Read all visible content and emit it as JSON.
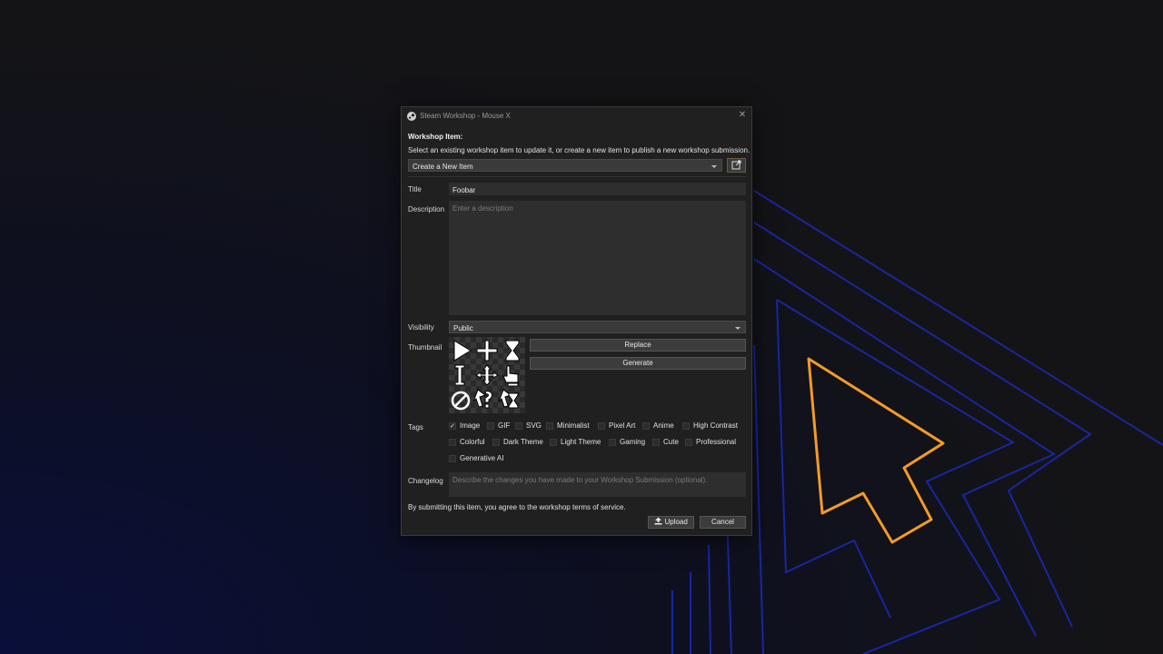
{
  "window": {
    "title": "Steam Workshop - Mouse X",
    "close": "✕"
  },
  "workshop": {
    "heading": "Workshop Item:",
    "subtitle": "Select an existing workshop item to update it, or create a new item to publish a new workshop submission.",
    "item_selected": "Create a New Item"
  },
  "form": {
    "title_label": "Title",
    "title_value": "Foobar",
    "description_label": "Description",
    "description_placeholder": "Enter a description",
    "visibility_label": "Visibility",
    "visibility_value": "Public",
    "thumbnail_label": "Thumbnail",
    "replace_label": "Replace",
    "generate_label": "Generate",
    "tags_label": "Tags",
    "tags": [
      {
        "label": "Image",
        "checked": true
      },
      {
        "label": "GIF",
        "checked": false
      },
      {
        "label": "SVG",
        "checked": false
      },
      {
        "label": "Minimalist",
        "checked": false
      },
      {
        "label": "Pixel Art",
        "checked": false
      },
      {
        "label": "Anime",
        "checked": false
      },
      {
        "label": "High Contrast",
        "checked": false
      },
      {
        "label": "Colorful",
        "checked": false
      },
      {
        "label": "Dark Theme",
        "checked": false
      },
      {
        "label": "Light Theme",
        "checked": false
      },
      {
        "label": "Gaming",
        "checked": false
      },
      {
        "label": "Cute",
        "checked": false
      },
      {
        "label": "Professional",
        "checked": false
      },
      {
        "label": "Generative AI",
        "checked": false
      }
    ],
    "changelog_label": "Changelog",
    "changelog_placeholder": "Describe the changes you have made to your Workshop Submission (optional)."
  },
  "footer": {
    "terms": "By submitting this item, you agree to the workshop terms of service.",
    "upload_label": "Upload",
    "cancel_label": "Cancel"
  },
  "colors": {
    "accent_orange": "#f39a2a",
    "accent_blue": "#2b3bd6"
  }
}
